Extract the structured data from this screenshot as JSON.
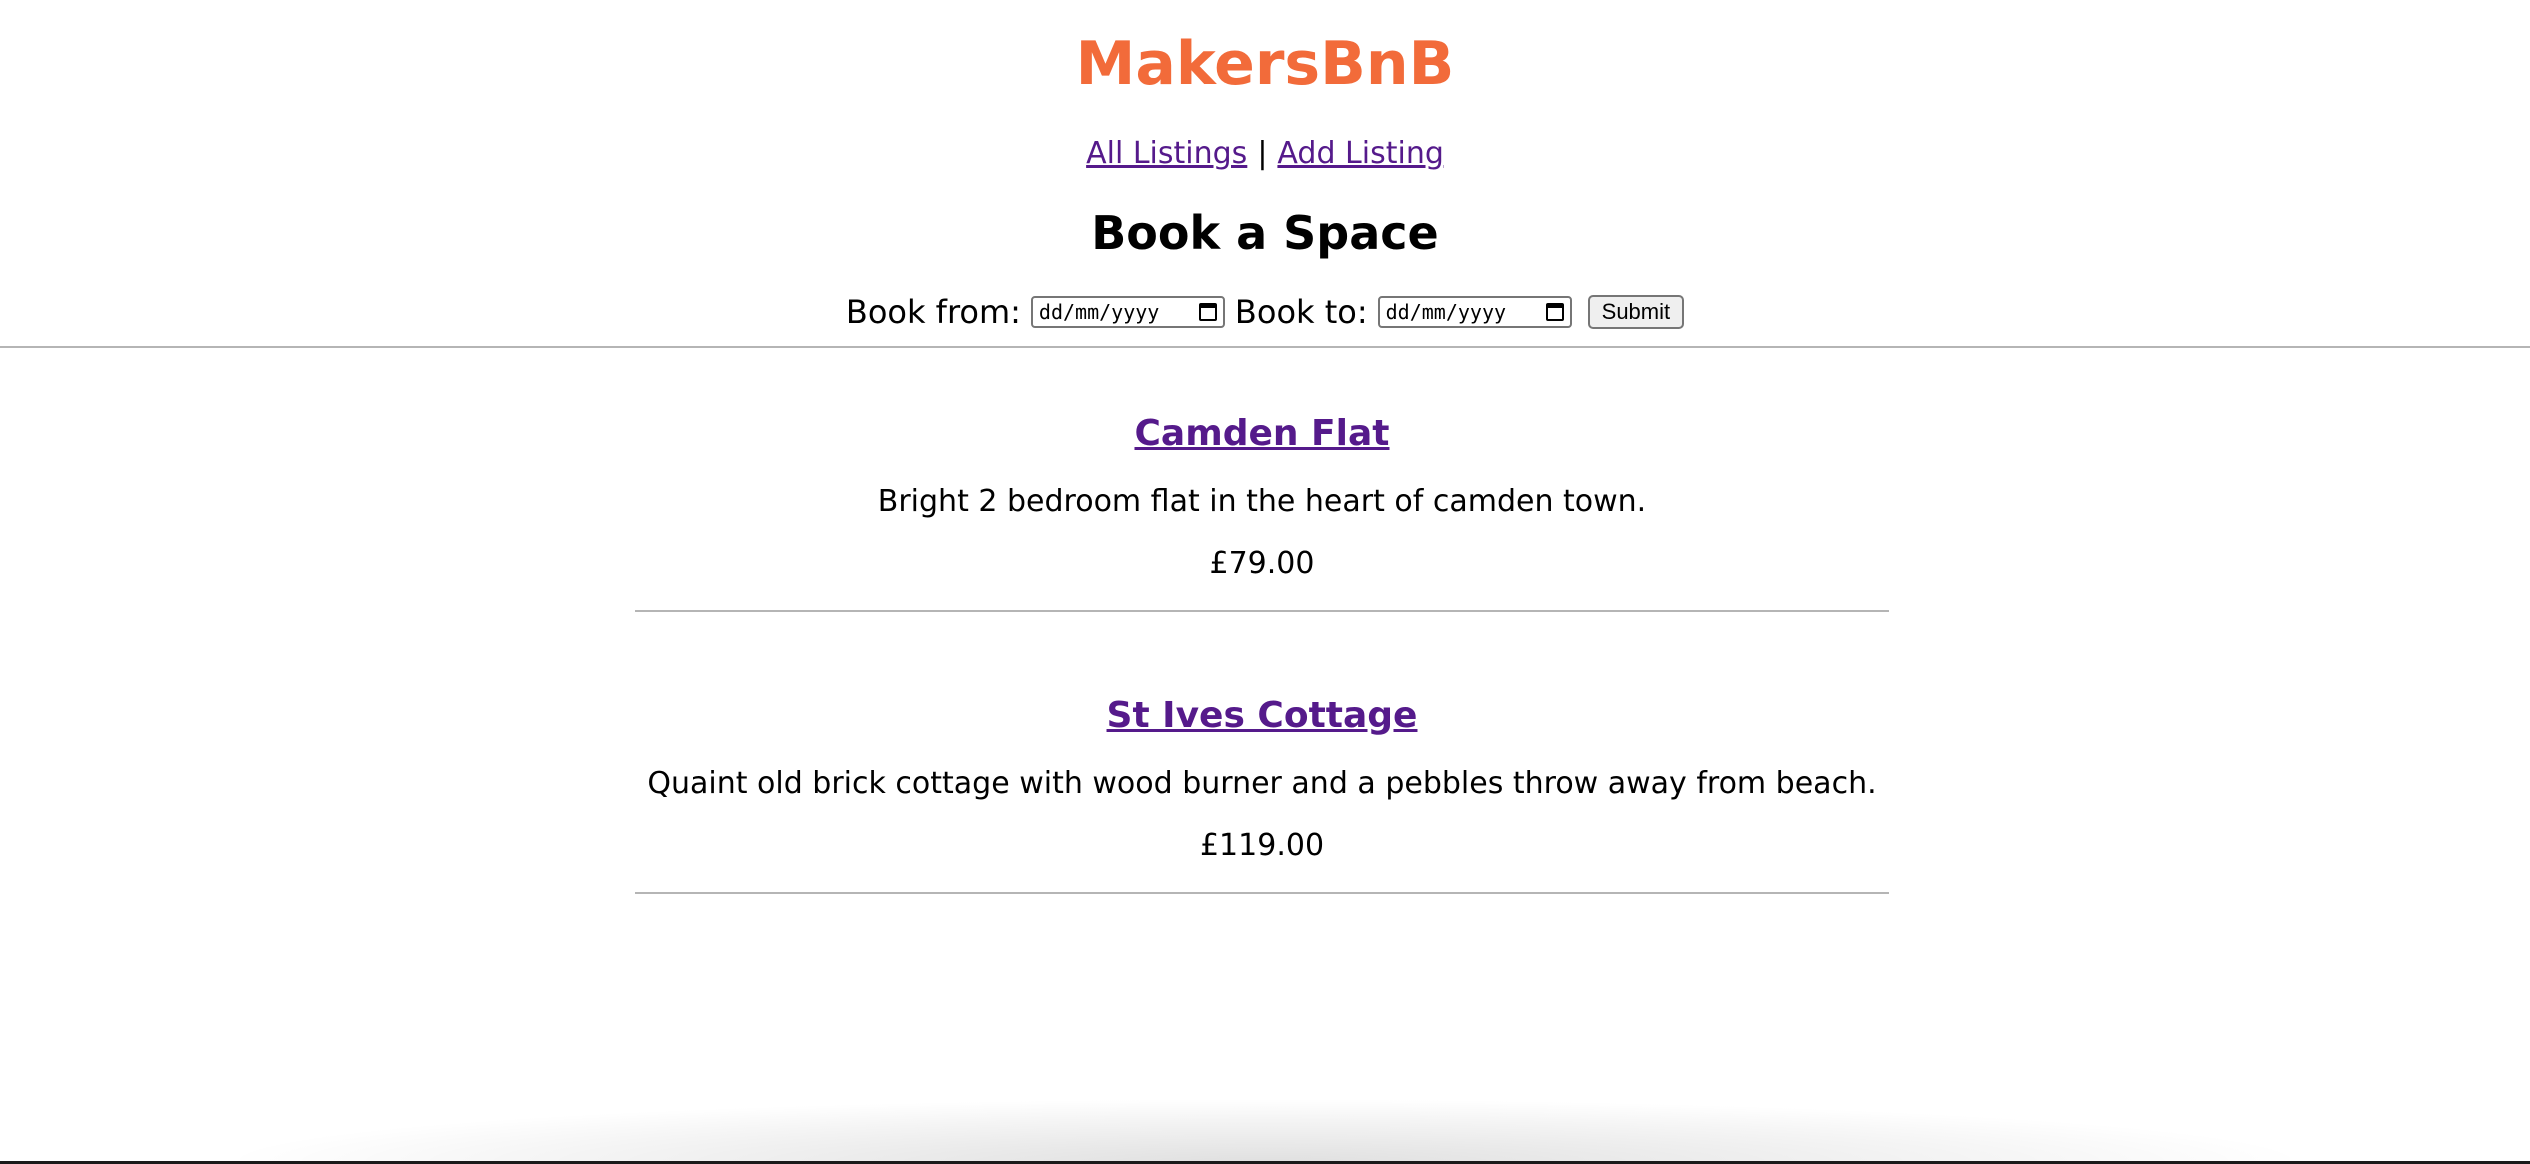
{
  "header": {
    "site_title": "MakersBnB",
    "brand_color": "#f26b3a",
    "link_color": "#551a8b"
  },
  "nav": {
    "all_listings": "All Listings",
    "separator": "|",
    "add_listing": "Add Listing"
  },
  "booking": {
    "heading": "Book a Space",
    "from_label": "Book from:",
    "from_value": "dd/mm/yyyy",
    "to_label": "Book to:",
    "to_value": "dd/mm/yyyy",
    "submit_label": "Submit"
  },
  "listings": [
    {
      "name": "Camden Flat",
      "description": "Bright 2 bedroom flat in the heart of camden town.",
      "price": "£79.00"
    },
    {
      "name": "St Ives Cottage",
      "description": "Quaint old brick cottage with wood burner and a pebbles throw away from beach.",
      "price": "£119.00"
    }
  ],
  "icons": {
    "calendar": "calendar-icon"
  }
}
